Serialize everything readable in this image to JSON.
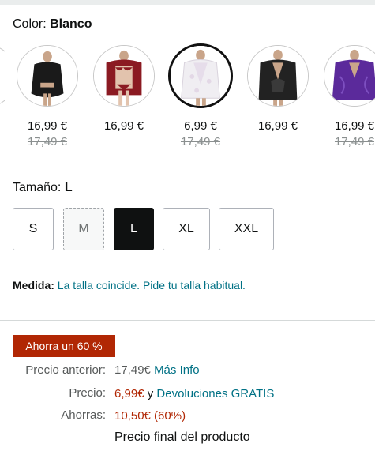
{
  "color": {
    "label": "Color: ",
    "value": "Blanco"
  },
  "swatches": [
    {
      "name": "black-lace",
      "price": "16,99 €",
      "old_price": "17,49 €",
      "fill": "#1a1a1a",
      "selected": false
    },
    {
      "name": "red-lace",
      "price": "16,99 €",
      "old_price": "",
      "fill": "#8b1a22",
      "selected": false
    },
    {
      "name": "white-lace",
      "price": "6,99 €",
      "old_price": "17,49 €",
      "fill": "#f0eef2",
      "selected": true
    },
    {
      "name": "black-robe",
      "price": "16,99 €",
      "old_price": "",
      "fill": "#222222",
      "selected": false
    },
    {
      "name": "purple-robe",
      "price": "16,99 €",
      "old_price": "17,49 €",
      "fill": "#5b2a9b",
      "selected": false
    }
  ],
  "size": {
    "label": "Tamaño: ",
    "value": "L",
    "options": [
      "S",
      "M",
      "L",
      "XL",
      "XXL"
    ]
  },
  "fit": {
    "label": "Medida:",
    "text": "La talla coincide. Pide tu talla habitual."
  },
  "savings_badge": "Ahorra un 60 %",
  "pricing": {
    "previous_label": "Precio anterior:",
    "previous_value": "17,49€",
    "more_info": "Más Info",
    "price_label": "Precio:",
    "price_value": "6,99€",
    "price_and": "y",
    "returns": "Devoluciones GRATIS",
    "savings_label": "Ahorras:",
    "savings_value": "10,50€ (60%)",
    "final_note": "Precio final del producto"
  },
  "colors": {
    "link": "#007185",
    "deal_red": "#b12704",
    "selected_size_bg": "#0f1111"
  }
}
